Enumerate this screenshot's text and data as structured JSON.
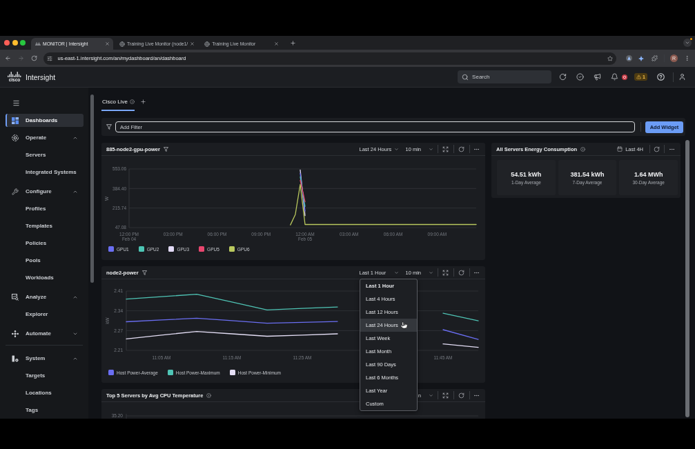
{
  "browser": {
    "tabs": [
      {
        "kind": "app",
        "title": "MONITOR | Intersight",
        "selected": true
      },
      {
        "kind": "web",
        "title": "Training Live Monitor (node1/",
        "selected": false
      },
      {
        "kind": "web",
        "title": "Training Live Monitor",
        "selected": false
      }
    ],
    "url": "us-east-1.intersight.com/an/mydashboard/an/dashboard",
    "profile_initial": "R"
  },
  "header": {
    "logo_text": "cisco",
    "app_name": "Intersight",
    "search_placeholder": "Search",
    "warning_count": "1"
  },
  "sidebar": {
    "items": [
      {
        "kind": "link",
        "label": "Dashboards",
        "selected": true
      },
      {
        "kind": "group",
        "label": "Operate",
        "expanded": true,
        "children": [
          {
            "label": "Servers",
            "selected": false
          },
          {
            "label": "Integrated Systems",
            "selected": false
          }
        ]
      },
      {
        "kind": "group",
        "label": "Configure",
        "expanded": true,
        "children": [
          {
            "label": "Profiles",
            "selected": false
          },
          {
            "label": "Templates",
            "selected": false
          },
          {
            "label": "Policies",
            "selected": false
          },
          {
            "label": "Pools",
            "selected": false
          },
          {
            "label": "Workloads",
            "selected": false
          }
        ]
      },
      {
        "kind": "group",
        "label": "Analyze",
        "expanded": true,
        "children": [
          {
            "label": "Explorer",
            "selected": false
          }
        ]
      },
      {
        "kind": "group",
        "label": "Automate",
        "expanded": false
      },
      {
        "kind": "group",
        "label": "System",
        "expanded": true,
        "children": [
          {
            "label": "Targets",
            "selected": false
          },
          {
            "label": "Locations",
            "selected": false
          },
          {
            "label": "Tags",
            "selected": false
          }
        ]
      }
    ]
  },
  "dashboard_tabs": [
    {
      "label": "Cisco Live",
      "selected": true
    }
  ],
  "filter": {
    "placeholder": "Add Filter"
  },
  "add_widget_button": "Add Widget",
  "widgets": [
    {
      "kind": "line_chart",
      "title": "885-node2-gpu-power",
      "range": "Last 24 Hours",
      "interval": "10 min",
      "chart_data": {
        "type": "line",
        "ylabel": "W",
        "ylim": [
          47.08,
          553.06
        ],
        "yticks": [
          {
            "value": 47.08,
            "label": "47.08"
          },
          {
            "value": 215.74,
            "label": "215.74"
          },
          {
            "value": 384.4,
            "label": "384.40"
          },
          {
            "value": 553.06,
            "label": "553.06"
          }
        ],
        "categories": [
          "12:00 PM\nFeb 04",
          null,
          null,
          null,
          null,
          null,
          null,
          null,
          null,
          "03:00 PM",
          null,
          null,
          null,
          null,
          null,
          null,
          null,
          null,
          "06:00 PM",
          null,
          null,
          null,
          null,
          null,
          null,
          null,
          null,
          "09:00 PM",
          null,
          null,
          null,
          null,
          null,
          null,
          null,
          null,
          "12:00 AM\nFeb 05",
          null,
          null,
          null,
          null,
          null,
          null,
          null,
          null,
          "03:00 AM",
          null,
          null,
          null,
          null,
          null,
          null,
          null,
          null,
          "06:00 AM",
          null,
          null,
          null,
          null,
          null,
          null,
          null,
          null,
          "09:00 AM",
          null,
          null,
          null,
          null,
          null,
          null,
          null,
          null
        ],
        "series": [
          {
            "name": "GPU1",
            "color": "#6a6ef2",
            "values": [
              null,
              null,
              null,
              null,
              null,
              null,
              null,
              null,
              null,
              null,
              null,
              null,
              null,
              null,
              null,
              null,
              null,
              null,
              null,
              null,
              null,
              null,
              null,
              null,
              null,
              null,
              null,
              null,
              null,
              null,
              null,
              null,
              null,
              null,
              null,
              515,
              190,
              null,
              null,
              null,
              null,
              null,
              null,
              null,
              null,
              null,
              null,
              null,
              null,
              null,
              null,
              null,
              null,
              null,
              null,
              null,
              null,
              null,
              null,
              null,
              null,
              null,
              null,
              null,
              null,
              null,
              null,
              null,
              null,
              null,
              null,
              null
            ]
          },
          {
            "name": "GPU2",
            "color": "#4cc5b4",
            "values": [
              null,
              null,
              null,
              null,
              null,
              null,
              null,
              null,
              null,
              null,
              null,
              null,
              null,
              null,
              null,
              null,
              null,
              null,
              null,
              null,
              null,
              null,
              null,
              null,
              null,
              null,
              null,
              null,
              null,
              null,
              null,
              null,
              null,
              null,
              null,
              485,
              230,
              null,
              null,
              null,
              null,
              null,
              null,
              null,
              null,
              null,
              null,
              null,
              null,
              null,
              null,
              null,
              null,
              null,
              null,
              null,
              null,
              null,
              null,
              null,
              null,
              null,
              null,
              null,
              null,
              null,
              null,
              null,
              null,
              null,
              null,
              null
            ]
          },
          {
            "name": "GPU3",
            "color": "#e2daf6",
            "values": [
              null,
              null,
              null,
              null,
              null,
              null,
              null,
              null,
              null,
              null,
              null,
              null,
              null,
              null,
              null,
              null,
              null,
              null,
              null,
              null,
              null,
              null,
              null,
              null,
              null,
              null,
              null,
              null,
              null,
              null,
              null,
              null,
              null,
              null,
              null,
              545,
              150,
              null,
              null,
              null,
              null,
              null,
              null,
              null,
              null,
              null,
              null,
              null,
              null,
              null,
              null,
              null,
              null,
              null,
              null,
              null,
              null,
              null,
              null,
              null,
              null,
              null,
              null,
              null,
              null,
              null,
              null,
              null,
              null,
              null,
              null,
              null
            ]
          },
          {
            "name": "GPU5",
            "color": "#e8466e",
            "values": [
              null,
              null,
              null,
              null,
              null,
              null,
              null,
              null,
              null,
              null,
              null,
              null,
              null,
              null,
              null,
              null,
              null,
              null,
              null,
              null,
              null,
              null,
              null,
              null,
              null,
              null,
              null,
              null,
              null,
              null,
              null,
              null,
              null,
              null,
              null,
              455,
              270,
              null,
              null,
              null,
              null,
              null,
              null,
              null,
              null,
              null,
              null,
              null,
              null,
              null,
              null,
              null,
              null,
              null,
              null,
              null,
              null,
              null,
              null,
              null,
              null,
              null,
              null,
              null,
              null,
              null,
              null,
              null,
              null,
              null,
              null,
              null
            ]
          },
          {
            "name": "GPU6",
            "color": "#b9c85e",
            "values": [
              null,
              null,
              null,
              null,
              null,
              null,
              null,
              null,
              null,
              null,
              null,
              null,
              null,
              null,
              null,
              null,
              null,
              null,
              null,
              null,
              null,
              null,
              null,
              null,
              null,
              null,
              null,
              null,
              null,
              null,
              null,
              null,
              null,
              70,
              160,
              420,
              74,
              74,
              74,
              74,
              74,
              74,
              74,
              74,
              74,
              74,
              74,
              74,
              74,
              74,
              74,
              74,
              74,
              74,
              74,
              74,
              74,
              74,
              74,
              74,
              74,
              74,
              74,
              74,
              74,
              74,
              74,
              74,
              74,
              74,
              74,
              74
            ]
          }
        ]
      }
    },
    {
      "kind": "line_chart",
      "title": "node2-power",
      "range": "Last 1 Hour",
      "interval": "10 min",
      "chart_data": {
        "type": "line",
        "ylabel": "kW",
        "ylim": [
          2.205,
          2.406
        ],
        "yticks": [
          {
            "value": 2.205,
            "label": "2.21"
          },
          {
            "value": 2.272,
            "label": "2.27"
          },
          {
            "value": 2.339,
            "label": "2.34"
          },
          {
            "value": 2.406,
            "label": "2.41"
          }
        ],
        "categories": [
          null,
          "11:05 AM",
          null,
          "11:15 AM",
          null,
          "11:25 AM",
          null,
          null,
          null,
          "11:45 AM",
          null
        ],
        "series": [
          {
            "name": "Host Power-Average",
            "color": "#6a6ef2",
            "values": [
              2.302,
              2.308,
              2.314,
              2.306,
              2.297,
              2.3,
              2.303,
              null,
              null,
              2.275,
              2.242
            ]
          },
          {
            "name": "Host Power-Maximum",
            "color": "#4fc4b5",
            "values": [
              2.379,
              2.387,
              2.395,
              2.369,
              2.342,
              2.347,
              2.352,
              null,
              null,
              2.331,
              2.305
            ]
          },
          {
            "name": "Host Power-Minimum",
            "color": "#e4def5",
            "values": [
              2.244,
              2.257,
              2.269,
              2.261,
              2.253,
              2.257,
              2.261,
              null,
              null,
              2.227,
              2.215
            ]
          }
        ]
      },
      "range_menu": {
        "open": true,
        "items": [
          {
            "label": "Last 1 Hour",
            "selected": true,
            "hovered": false
          },
          {
            "label": "Last 4 Hours",
            "selected": false,
            "hovered": false
          },
          {
            "label": "Last 12 Hours",
            "selected": false,
            "hovered": false
          },
          {
            "label": "Last 24 Hours",
            "selected": false,
            "hovered": true
          },
          {
            "label": "Last Week",
            "selected": false,
            "hovered": false
          },
          {
            "label": "Last Month",
            "selected": false,
            "hovered": false
          },
          {
            "label": "Last 90 Days",
            "selected": false,
            "hovered": false
          },
          {
            "label": "Last 6 Months",
            "selected": false,
            "hovered": false
          },
          {
            "label": "Last Year",
            "selected": false,
            "hovered": false
          },
          {
            "label": "Custom",
            "selected": false,
            "hovered": false
          }
        ]
      }
    },
    {
      "kind": "clipped",
      "title": "Top 5 Servers by Avg CPU Temperature",
      "interval": "n",
      "ytick_label": "35.20"
    }
  ],
  "energy_card": {
    "title": "All Servers Energy Consumption",
    "range": "Last 4H",
    "stats": [
      {
        "value": "54.51 kWh",
        "label": "1-Day Average"
      },
      {
        "value": "381.54 kWh",
        "label": "7-Day Average"
      },
      {
        "value": "1.64 MWh",
        "label": "30-Day Average"
      }
    ]
  }
}
